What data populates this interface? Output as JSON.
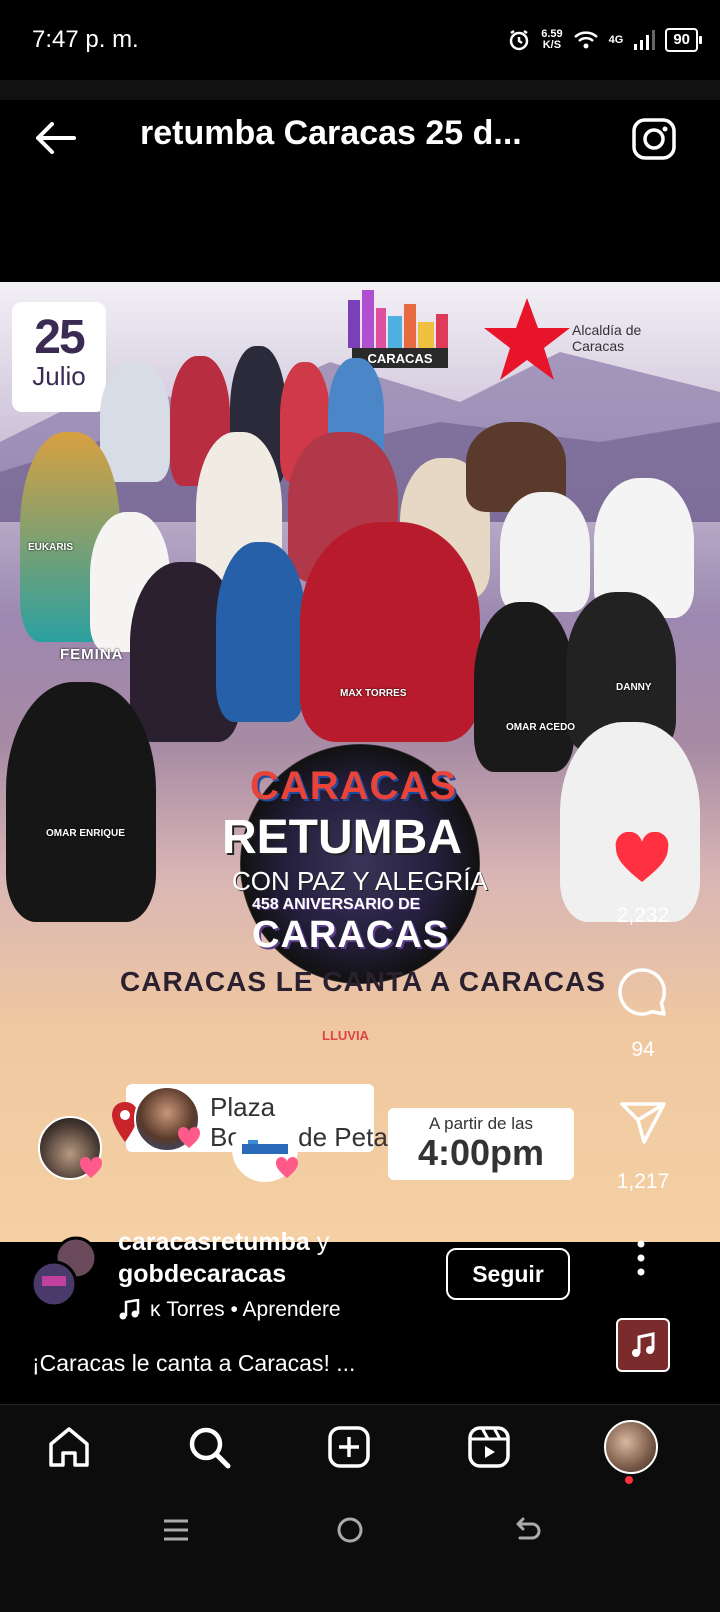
{
  "status_bar": {
    "time": "7:47 p. m.",
    "speed_value": "6.59",
    "speed_unit": "K/S",
    "network": "4G",
    "battery": "90"
  },
  "header": {
    "title": "retumba Caracas 25 d...",
    "back_icon": "arrow-left-icon",
    "camera_icon": "camera-icon"
  },
  "flyer": {
    "date_day": "25",
    "date_month": "Julio",
    "alcaldia": "Alcaldía de Caracas",
    "caracas_logo_text": "CARACAS",
    "femina": "FEMINA",
    "logo_caracas": "CARACAS",
    "logo_retumba": "RETUMBA",
    "logo_paz": "CON PAZ Y ALEGRÍA",
    "anniversary": "458 ANIVERSARIO DE",
    "anniversary_city": "CARACAS",
    "tagline": "CARACAS LE CANTA A CARACAS",
    "lluvia": "LLUVIA",
    "plaza_line1": "Plaza",
    "plaza_line2": "Bolívar de Petare",
    "time_small": "A partir de las",
    "time_big": "4:00pm",
    "artist_tags": [
      "MAX TORRES",
      "OMAR ENRIQUE",
      "OMAR ACEDO",
      "FEMINA",
      "EUKARIS",
      "DANNY"
    ]
  },
  "actions": {
    "like_count": "2,232",
    "comment_count": "94",
    "share_count": "1,217"
  },
  "author": {
    "line1_name": "caracasretumba",
    "line1_conj": " y",
    "line2": "gobdecaracas",
    "music": "κ Torres • Aprendere",
    "follow_label": "Seguir"
  },
  "caption": "¡Caracas le canta a Caracas! ...",
  "colors": {
    "like_red": "#ff3040",
    "background": "#000000"
  }
}
